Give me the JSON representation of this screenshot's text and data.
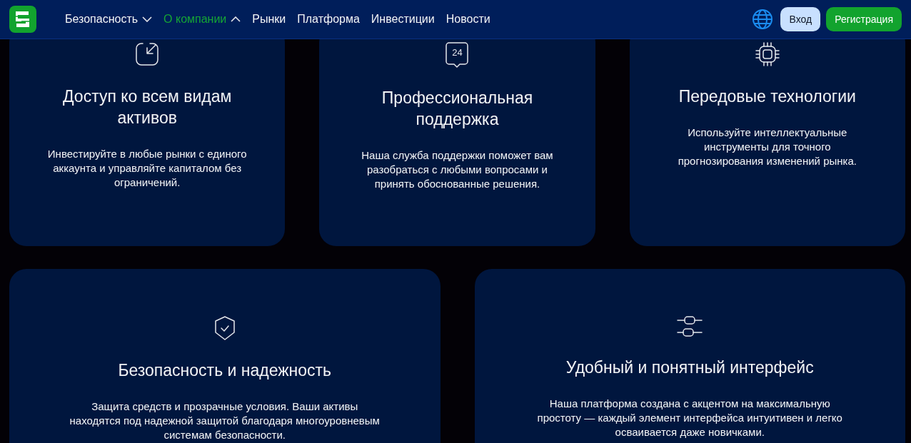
{
  "nav": [
    {
      "label": "Безопасность",
      "kind": "dropdown",
      "expanded": false,
      "selected": false
    },
    {
      "label": "О компании",
      "kind": "dropdown",
      "expanded": true,
      "selected": true
    },
    {
      "label": "Рынки",
      "kind": "link",
      "selected": false
    },
    {
      "label": "Платформа",
      "kind": "link",
      "selected": false
    },
    {
      "label": "Инвестиции",
      "kind": "link",
      "selected": false
    },
    {
      "label": "Новости",
      "kind": "link",
      "selected": false
    }
  ],
  "login": "Вход",
  "register": "Регистрация",
  "features_top": [
    {
      "title": "Доступ ко всем видам активов",
      "text": "Инвестируйте в любые рынки с единого аккаунта и управляйте капиталом без ограничений."
    },
    {
      "title": "Профессиональная поддержка",
      "text": "Наша служба поддержки поможет вам разобраться с любыми вопросами и принять обоснованные решения.",
      "icon_text": "24"
    },
    {
      "title": "Передовые технологии",
      "text": "Используйте интеллектуальные инструменты для точного прогнозирования изменений рынка."
    }
  ],
  "features_bottom": [
    {
      "title": "Безопасность и надежность",
      "text": "Защита средств и прозрачные условия. Ваши активы находятся под надежной защитой благодаря многоуровневым системам безопасности."
    },
    {
      "title": "Удобный и понятный интерфейс",
      "text": "Наша платформа создана с акцентом на максимальную простоту — каждый элемент интерфейса интуитивен и легко осваивается даже новичками."
    }
  ]
}
